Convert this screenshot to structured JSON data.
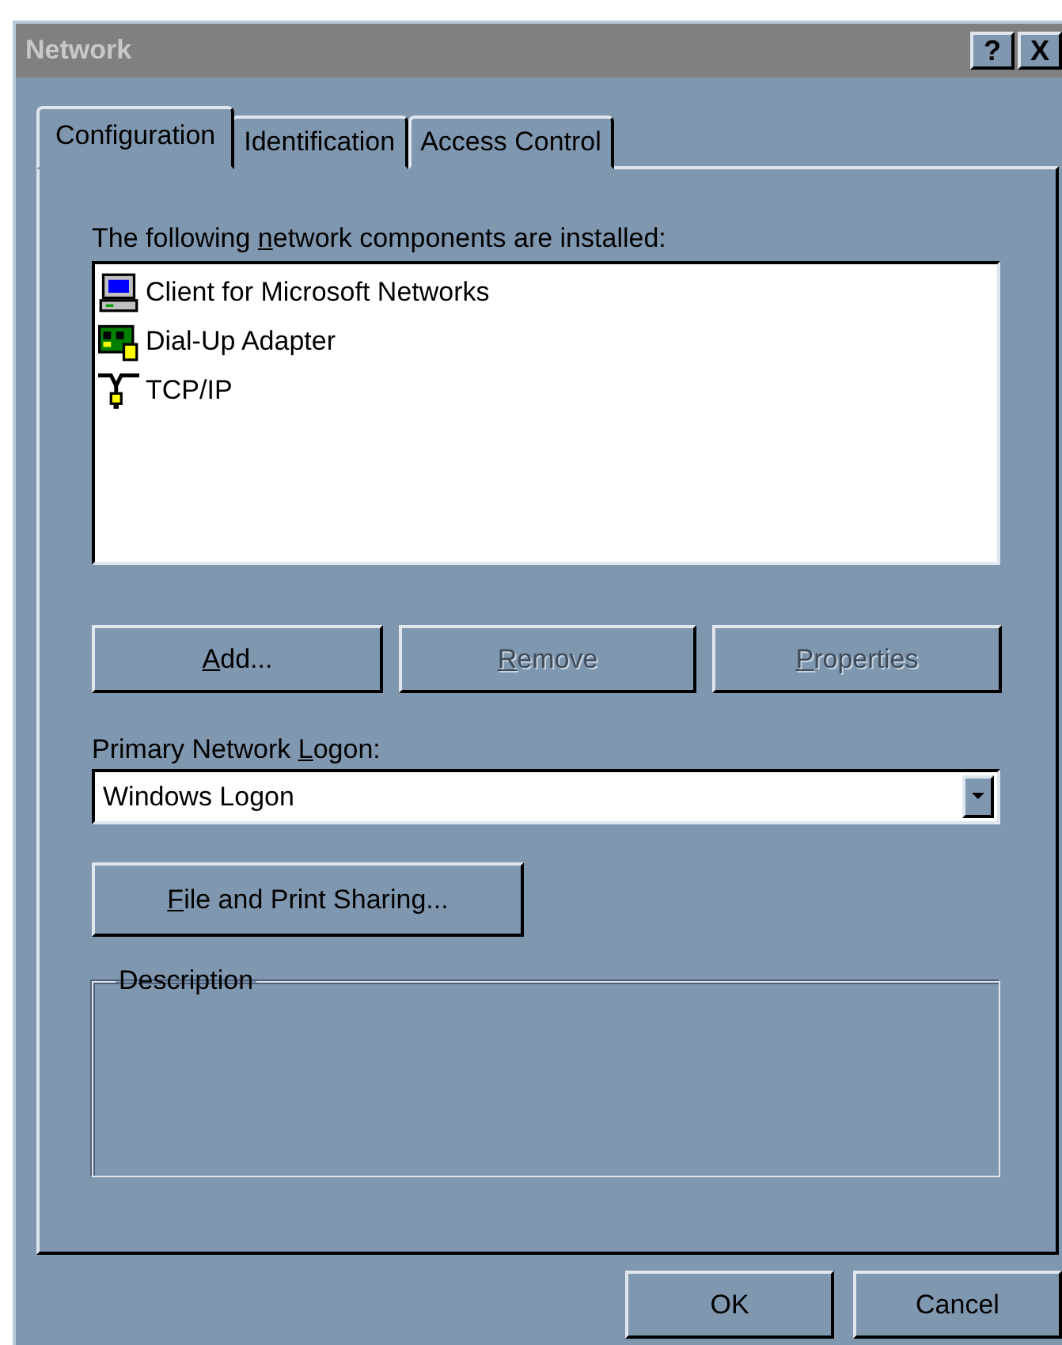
{
  "window": {
    "title": "Network",
    "title_buttons": [
      "?",
      "X"
    ]
  },
  "tabs": [
    {
      "label": "Configuration",
      "selected": true
    },
    {
      "label": "Identification",
      "selected": false
    },
    {
      "label": "Access Control",
      "selected": false
    }
  ],
  "components_label": {
    "before": "The following ",
    "key": "n",
    "after": "etwork components are installed:"
  },
  "components": [
    {
      "name": "Client for Microsoft Networks",
      "kind": "client"
    },
    {
      "name": "Dial-Up Adapter",
      "kind": "adapter"
    },
    {
      "name": "TCP/IP",
      "kind": "protocol"
    }
  ],
  "component_buttons": [
    {
      "key": "A",
      "after": "dd...",
      "disabled": false
    },
    {
      "key": "R",
      "after": "emove",
      "disabled": true
    },
    {
      "key": "P",
      "after": "roperties",
      "disabled": true
    }
  ],
  "logon_label": {
    "before": "Primary Network ",
    "key": "L",
    "after": "ogon:"
  },
  "logon_select": {
    "value": "Windows Logon"
  },
  "sharing_button": {
    "key": "F",
    "after": "ile and Print Sharing...",
    "disabled": false
  },
  "description": {
    "title": "Description"
  },
  "dialog_buttons": [
    {
      "label": "OK",
      "disabled": false
    },
    {
      "label": "Cancel",
      "disabled": false
    }
  ]
}
